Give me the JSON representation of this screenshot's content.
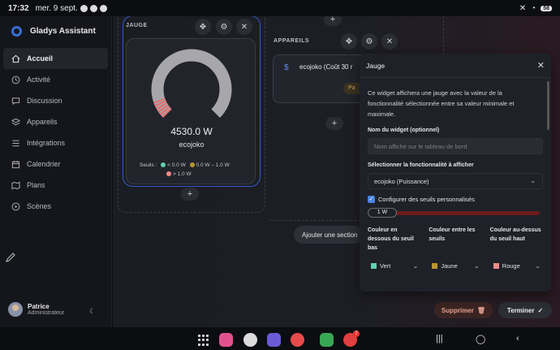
{
  "statusbar": {
    "time": "17:32",
    "date": "mer. 9 sept.",
    "battery": "58"
  },
  "sidebar": {
    "brand": "Gladys Assistant",
    "items": [
      {
        "label": "Accueil",
        "icon": "home-icon",
        "active": true
      },
      {
        "label": "Activité",
        "icon": "clock-icon"
      },
      {
        "label": "Discussion",
        "icon": "chat-icon"
      },
      {
        "label": "Appareils",
        "icon": "layers-icon"
      },
      {
        "label": "Intégrations",
        "icon": "list-icon"
      },
      {
        "label": "Calendrier",
        "icon": "calendar-icon"
      },
      {
        "label": "Plans",
        "icon": "map-icon"
      },
      {
        "label": "Scènes",
        "icon": "play-icon"
      }
    ],
    "user": {
      "name": "Patrice",
      "role": "Administrateur"
    }
  },
  "columns": {
    "gauge_label": "JAUGE",
    "devices_label": "APPAREILS"
  },
  "gauge": {
    "value_text": "4530.0 W",
    "device": "ecojoko",
    "thresholds_label": "Seuils :",
    "t1": "< 0.0 W",
    "t2": "0.0 W – 1.0 W",
    "t3": "> 1.0 W",
    "fill_fraction": 1.0,
    "colors": {
      "green": "#5fd1b3",
      "yellow": "#b8962e",
      "red": "#f08a8a"
    }
  },
  "devices_card": {
    "title": "ecojoko (Coût 30 r",
    "tag": "Pa"
  },
  "add_section_label": "Ajouter une section",
  "modal": {
    "title": "Jauge",
    "description": "Ce widget affichera une jauge avec la valeur de la fonctionnalité sélectionnée entre sa valeur minimale et maximale.",
    "name_label": "Nom du widget (optionnel)",
    "name_placeholder": "Nom affiché sur le tableau de bord",
    "feature_label": "Sélectionner la fonctionnalité à afficher",
    "feature_value": "ecojoko (Puissance)",
    "custom_thresholds_label": "Configurer des seuils personnalisés",
    "slider_value": "1 W",
    "color_below_label": "Couleur en dessous du seuil bas",
    "color_between_label": "Couleur entre les seuils",
    "color_above_label": "Couleur au-dessus du seuil haut",
    "color_below_value": "Vert",
    "color_between_value": "Jaune",
    "color_above_value": "Rouge"
  },
  "actions": {
    "delete": "Supprimer",
    "done": "Terminer"
  },
  "navbar": {
    "badge": "7"
  }
}
